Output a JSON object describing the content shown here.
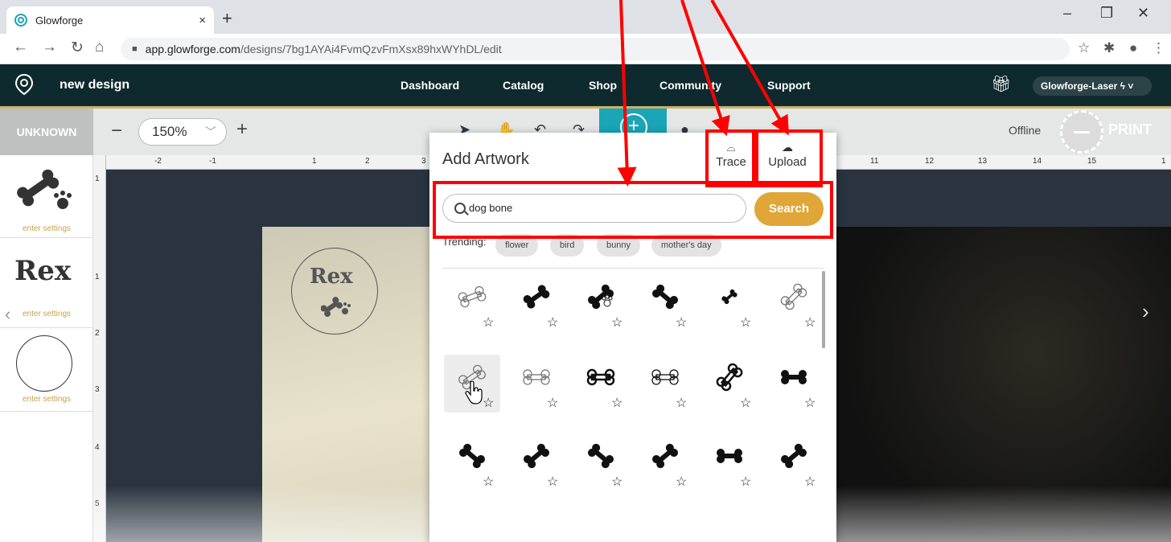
{
  "browser": {
    "tab_title": "Glowforge",
    "tab_close": "×",
    "new_tab": "+",
    "url_host": "app.glowforge.com",
    "url_path": "/designs/7bg1AYAi4FvmQzvFmXsx89hxWYhDL/edit",
    "window_min": "–",
    "window_max": "❐",
    "window_close": "✕"
  },
  "topnav": {
    "design_name": "new design",
    "items": [
      "Dashboard",
      "Catalog",
      "Shop",
      "Community",
      "Support"
    ],
    "machine": "Glowforge-Laser ϟ ˅"
  },
  "toolbar": {
    "material": "UNKNOWN",
    "zoom_minus": "−",
    "zoom_value": "150%",
    "zoom_plus": "+",
    "status": "Offline",
    "print_label": "PRINT"
  },
  "sidebar": {
    "items": [
      {
        "label": "enter settings"
      },
      {
        "label": "enter settings",
        "text": "Rex"
      },
      {
        "label": "enter settings"
      }
    ]
  },
  "ruler": {
    "h_numbers": [
      "-2",
      "-1",
      "1",
      "2",
      "3",
      "11",
      "12",
      "13",
      "14",
      "15",
      "1"
    ],
    "v_numbers": [
      "1",
      "1",
      "2",
      "3",
      "4",
      "5"
    ]
  },
  "canvas": {
    "engraving_text": "Rex"
  },
  "add_artwork": {
    "title": "Add Artwork",
    "trace_label": "Trace",
    "upload_label": "Upload",
    "search_value": "dog bone",
    "search_button": "Search",
    "trending_label": "Trending:",
    "trending": [
      "flower",
      "bird",
      "bunny",
      "mother's day"
    ],
    "results": [
      {
        "style": "outline-thin"
      },
      {
        "style": "solid"
      },
      {
        "style": "solid-paw"
      },
      {
        "style": "solid"
      },
      {
        "style": "solid-small"
      },
      {
        "style": "outline-sketch"
      },
      {
        "style": "outline-sketch"
      },
      {
        "style": "outline-thin"
      },
      {
        "style": "outline-bold"
      },
      {
        "style": "outline-double"
      },
      {
        "style": "outline-bold"
      },
      {
        "style": "solid"
      },
      {
        "style": "solid"
      },
      {
        "style": "solid"
      },
      {
        "style": "solid"
      },
      {
        "style": "solid"
      },
      {
        "style": "solid"
      },
      {
        "style": "solid"
      }
    ],
    "star": "☆"
  },
  "colors": {
    "annotation_red": "#ff0000",
    "nav_bg": "#0e2a2e",
    "search_gold": "#e0a637",
    "add_teal": "#1aa6b7"
  }
}
